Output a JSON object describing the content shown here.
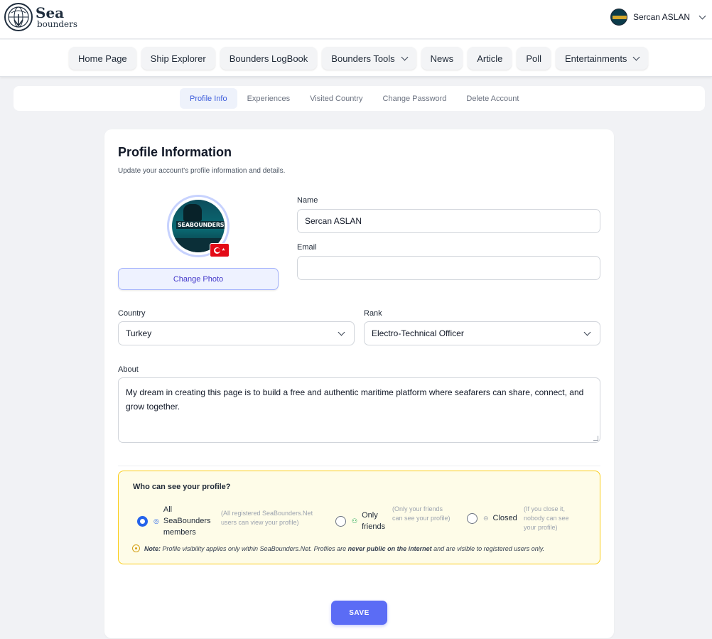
{
  "brand": {
    "line1": "Sea",
    "line2": "bounders"
  },
  "user": {
    "name": "Sercan ASLAN"
  },
  "nav": [
    {
      "label": "Home Page",
      "has_dropdown": false
    },
    {
      "label": "Ship Explorer",
      "has_dropdown": false
    },
    {
      "label": "Bounders LogBook",
      "has_dropdown": false
    },
    {
      "label": "Bounders Tools",
      "has_dropdown": true
    },
    {
      "label": "News",
      "has_dropdown": false
    },
    {
      "label": "Article",
      "has_dropdown": false
    },
    {
      "label": "Poll",
      "has_dropdown": false
    },
    {
      "label": "Entertainments",
      "has_dropdown": true
    }
  ],
  "tabs": [
    {
      "label": "Profile Info",
      "active": true
    },
    {
      "label": "Experiences",
      "active": false
    },
    {
      "label": "Visited Country",
      "active": false
    },
    {
      "label": "Change Password",
      "active": false
    },
    {
      "label": "Delete Account",
      "active": false
    }
  ],
  "profile": {
    "title": "Profile Information",
    "subtitle": "Update your account's profile information and details.",
    "avatar_text": "SEABOUNDERS.NET",
    "change_photo": "Change Photo",
    "name_label": "Name",
    "name_value": "Sercan ASLAN",
    "email_label": "Email",
    "email_value": "",
    "country_label": "Country",
    "country_value": "Turkey",
    "rank_label": "Rank",
    "rank_value": "Electro-Technical Officer",
    "about_label": "About",
    "about_value": "My dream in creating this page is to build a free and authentic maritime platform where seafarers can share, connect, and grow together."
  },
  "visibility": {
    "title": "Who can see your profile?",
    "options": [
      {
        "label": "All SeaBounders members",
        "hint": "(All registered SeaBounders.Net users can view your profile)",
        "checked": true
      },
      {
        "label": "Only friends",
        "hint": "(Only your friends can see your profile)",
        "checked": false
      },
      {
        "label": "Closed",
        "hint": "(If you close it, nobody can see your profile)",
        "checked": false
      }
    ],
    "note_prefix": "Note:",
    "note_text": " Profile visibility applies only within SeaBounders.Net. Profiles are ",
    "note_bold": "never public on the internet",
    "note_suffix": " and are visible to registered users only."
  },
  "save_label": "SAVE",
  "colors": {
    "accent": "#5b6cf5",
    "tab_active": "#3b5bdb",
    "note_border": "#facc15"
  }
}
